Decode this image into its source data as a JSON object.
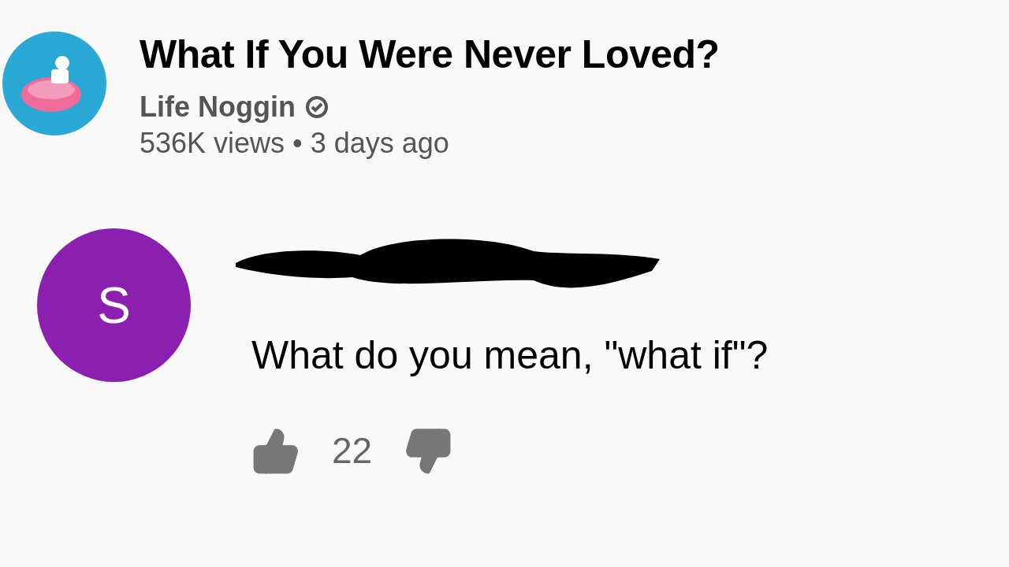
{
  "video": {
    "title": "What If You Were Never Loved?",
    "channel": "Life Noggin",
    "verified": true,
    "meta": "536K views • 3 days ago"
  },
  "comment": {
    "avatar_letter": "S",
    "text": "What do you mean, \"what if\"?",
    "likes": "22"
  }
}
